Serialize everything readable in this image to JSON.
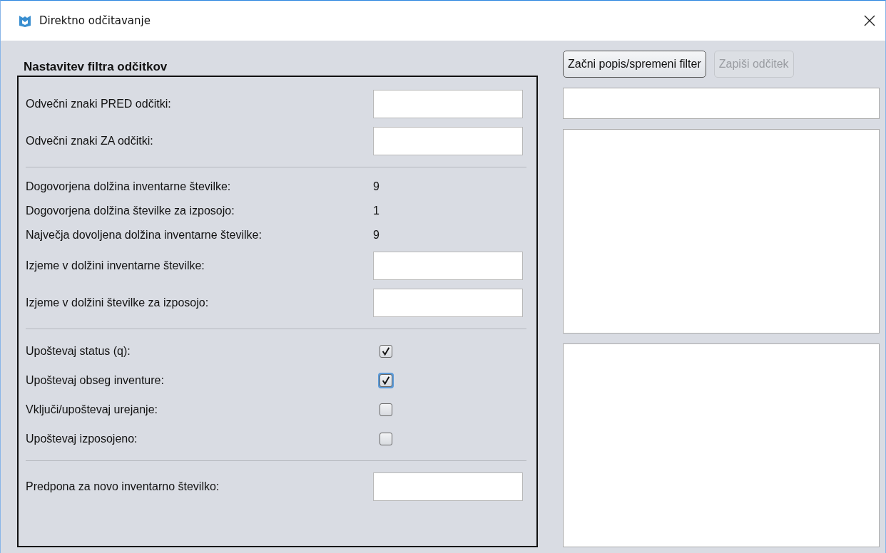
{
  "window": {
    "title": "Direktno odčitavanje"
  },
  "filter": {
    "title": "Nastavitev filtra odčitkov",
    "groups": [
      {
        "items": [
          {
            "kind": "field",
            "label": "Odvečni znaki PRED odčitki:"
          },
          {
            "kind": "field",
            "label": "Odvečni znaki ZA odčitki:"
          }
        ]
      },
      {
        "items": [
          {
            "kind": "value",
            "label": "Dogovorjena dolžina inventarne številke:",
            "value": "9"
          },
          {
            "kind": "value",
            "label": "Dogovorjena dolžina številke za izposojo:",
            "value": "1"
          },
          {
            "kind": "value",
            "label": "Največja dovoljena dolžina inventarne številke:",
            "value": "9"
          },
          {
            "kind": "field",
            "label": "Izjeme v dolžini inventarne številke:"
          },
          {
            "kind": "field",
            "label": "Izjeme v dolžini številke za izposojo:"
          }
        ]
      },
      {
        "items": [
          {
            "kind": "checkbox",
            "label": "Upoštevaj status (q):",
            "checked": true,
            "focused": false
          },
          {
            "kind": "checkbox",
            "label": "Upoštevaj obseg inventure:",
            "checked": true,
            "focused": true
          },
          {
            "kind": "checkbox",
            "label": "Vključi/upoštevaj urejanje:",
            "checked": false,
            "focused": false
          },
          {
            "kind": "checkbox",
            "label": "Upoštevaj izposojeno:",
            "checked": false,
            "focused": false
          }
        ]
      },
      {
        "items": [
          {
            "kind": "field",
            "label": "Predpona za novo inventarno številko:"
          }
        ]
      }
    ]
  },
  "buttons": [
    {
      "label": "Začni popis/spremeni filter",
      "disabled": false
    },
    {
      "label": "Zapiši odčitek",
      "disabled": true
    }
  ]
}
